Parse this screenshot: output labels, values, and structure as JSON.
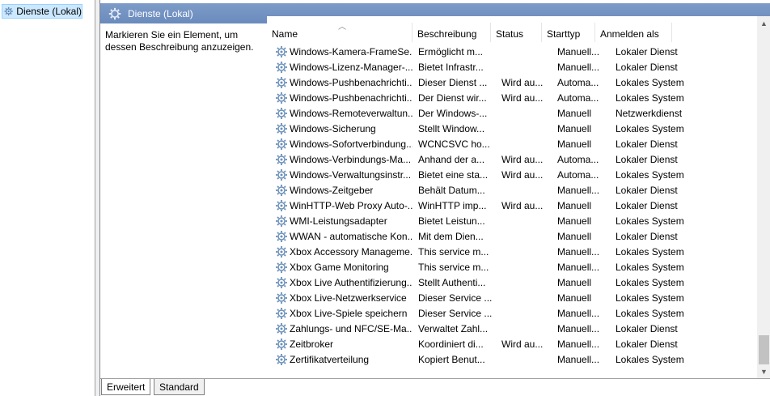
{
  "tree": {
    "item_label": "Dienste (Lokal)"
  },
  "header": {
    "title": "Dienste (Lokal)"
  },
  "description_hint": "Markieren Sie ein Element, um dessen Beschreibung anzuzeigen.",
  "columns": {
    "name": "Name",
    "description": "Beschreibung",
    "status": "Status",
    "startup": "Starttyp",
    "logon": "Anmelden als"
  },
  "rows": [
    {
      "name": "Windows-Kamera-FrameSe...",
      "description": "Ermöglicht m...",
      "status": "",
      "startup": "Manuell...",
      "logon": "Lokaler Dienst"
    },
    {
      "name": "Windows-Lizenz-Manager-...",
      "description": "Bietet Infrastr...",
      "status": "",
      "startup": "Manuell...",
      "logon": "Lokaler Dienst"
    },
    {
      "name": "Windows-Pushbenachrichti...",
      "description": "Dieser Dienst ...",
      "status": "Wird au...",
      "startup": "Automa...",
      "logon": "Lokales System"
    },
    {
      "name": "Windows-Pushbenachrichti...",
      "description": "Der Dienst wir...",
      "status": "Wird au...",
      "startup": "Automa...",
      "logon": "Lokales System"
    },
    {
      "name": "Windows-Remoteverwaltun...",
      "description": "Der Windows-...",
      "status": "",
      "startup": "Manuell",
      "logon": "Netzwerkdienst"
    },
    {
      "name": "Windows-Sicherung",
      "description": "Stellt Window...",
      "status": "",
      "startup": "Manuell",
      "logon": "Lokales System"
    },
    {
      "name": "Windows-Sofortverbindung...",
      "description": "WCNCSVC ho...",
      "status": "",
      "startup": "Manuell",
      "logon": "Lokaler Dienst"
    },
    {
      "name": "Windows-Verbindungs-Ma...",
      "description": "Anhand der a...",
      "status": "Wird au...",
      "startup": "Automa...",
      "logon": "Lokaler Dienst"
    },
    {
      "name": "Windows-Verwaltungsinstr...",
      "description": "Bietet eine sta...",
      "status": "Wird au...",
      "startup": "Automa...",
      "logon": "Lokales System"
    },
    {
      "name": "Windows-Zeitgeber",
      "description": "Behält Datum...",
      "status": "",
      "startup": "Manuell...",
      "logon": "Lokaler Dienst"
    },
    {
      "name": "WinHTTP-Web Proxy Auto-...",
      "description": "WinHTTP imp...",
      "status": "Wird au...",
      "startup": "Manuell",
      "logon": "Lokaler Dienst"
    },
    {
      "name": "WMI-Leistungsadapter",
      "description": "Bietet Leistun...",
      "status": "",
      "startup": "Manuell",
      "logon": "Lokales System"
    },
    {
      "name": "WWAN - automatische Kon...",
      "description": "Mit dem Dien...",
      "status": "",
      "startup": "Manuell",
      "logon": "Lokaler Dienst"
    },
    {
      "name": "Xbox Accessory Manageme...",
      "description": "This service m...",
      "status": "",
      "startup": "Manuell...",
      "logon": "Lokales System"
    },
    {
      "name": "Xbox Game Monitoring",
      "description": "This service m...",
      "status": "",
      "startup": "Manuell...",
      "logon": "Lokales System"
    },
    {
      "name": "Xbox Live Authentifizierung...",
      "description": "Stellt Authenti...",
      "status": "",
      "startup": "Manuell",
      "logon": "Lokales System"
    },
    {
      "name": "Xbox Live-Netzwerkservice",
      "description": "Dieser Service ...",
      "status": "",
      "startup": "Manuell",
      "logon": "Lokales System"
    },
    {
      "name": "Xbox Live-Spiele speichern",
      "description": "Dieser Service ...",
      "status": "",
      "startup": "Manuell...",
      "logon": "Lokales System"
    },
    {
      "name": "Zahlungs- und NFC/SE-Ma...",
      "description": "Verwaltet Zahl...",
      "status": "",
      "startup": "Manuell...",
      "logon": "Lokaler Dienst"
    },
    {
      "name": "Zeitbroker",
      "description": "Koordiniert di...",
      "status": "Wird au...",
      "startup": "Manuell...",
      "logon": "Lokaler Dienst"
    },
    {
      "name": "Zertifikatverteilung",
      "description": "Kopiert Benut...",
      "status": "",
      "startup": "Manuell...",
      "logon": "Lokales System"
    }
  ],
  "tabs": {
    "extended": "Erweitert",
    "standard": "Standard"
  },
  "colors": {
    "header_bg": "#6f8fc0",
    "selection_bg": "#cce8ff",
    "gear": "#6a8fb8"
  },
  "icons": {
    "service": "gear-icon"
  }
}
